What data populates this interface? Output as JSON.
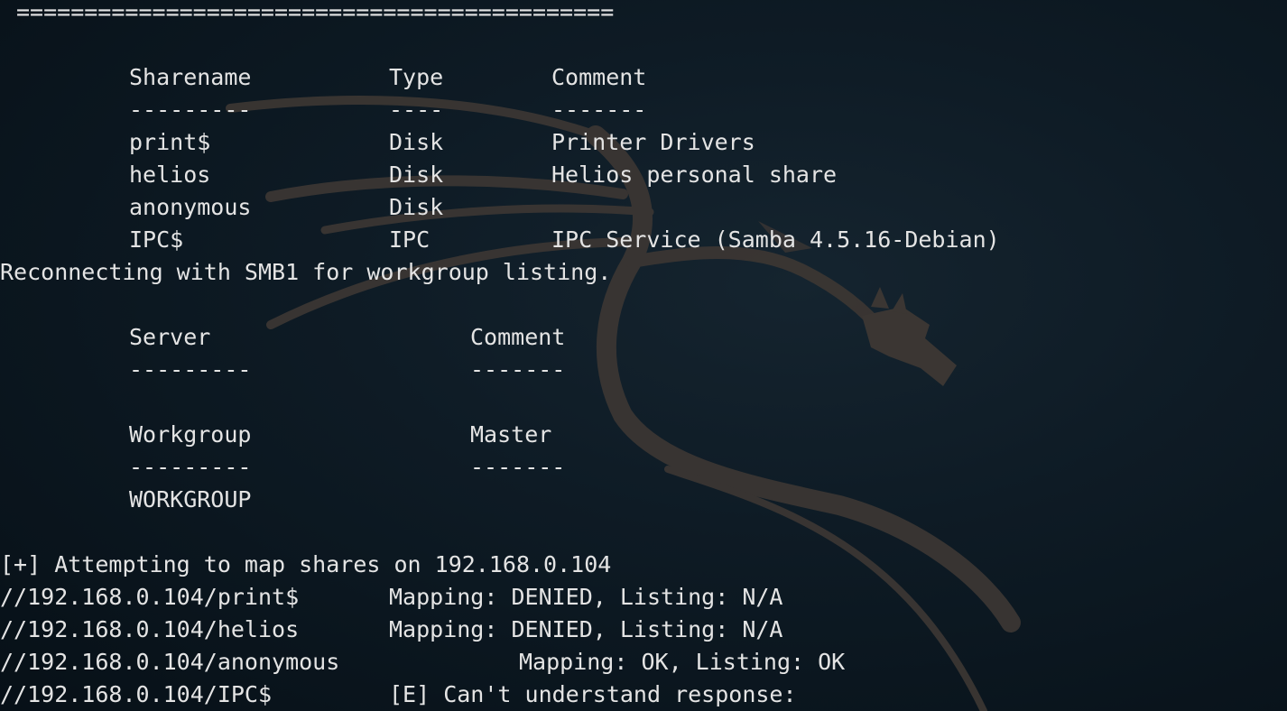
{
  "separator": "============================================",
  "shares": {
    "headers": [
      "Sharename",
      "Type",
      "Comment"
    ],
    "underlines": [
      "---------",
      "----",
      "-------"
    ],
    "rows": [
      {
        "name": "print$",
        "type": "Disk",
        "comment": "Printer Drivers"
      },
      {
        "name": "helios",
        "type": "Disk",
        "comment": "Helios personal share"
      },
      {
        "name": "anonymous",
        "type": "Disk",
        "comment": ""
      },
      {
        "name": "IPC$",
        "type": "IPC",
        "comment": "IPC Service (Samba 4.5.16-Debian)"
      }
    ]
  },
  "reconnect_msg": "Reconnecting with SMB1 for workgroup listing.",
  "servers": {
    "headers": [
      "Server",
      "Comment"
    ],
    "underlines": [
      "---------",
      "-------"
    ]
  },
  "workgroups": {
    "headers": [
      "Workgroup",
      "Master"
    ],
    "underlines": [
      "---------",
      "-------"
    ],
    "rows": [
      {
        "name": "WORKGROUP",
        "master": ""
      }
    ]
  },
  "mapping": {
    "attempt": "[+] Attempting to map shares on 192.168.0.104",
    "results": [
      {
        "path": "//192.168.0.104/print$",
        "result": "Mapping: DENIED, Listing: N/A"
      },
      {
        "path": "//192.168.0.104/helios",
        "result": "Mapping: DENIED, Listing: N/A"
      },
      {
        "path": "//192.168.0.104/anonymous",
        "result": "Mapping: OK, Listing: OK"
      },
      {
        "path": "//192.168.0.104/IPC$",
        "result": "[E] Can't understand response:"
      }
    ]
  },
  "colors": {
    "background": "#0e1b25",
    "text": "#e4e4e4",
    "watermark": "#3b3633"
  },
  "watermark_icon": "kali-dragon-icon"
}
